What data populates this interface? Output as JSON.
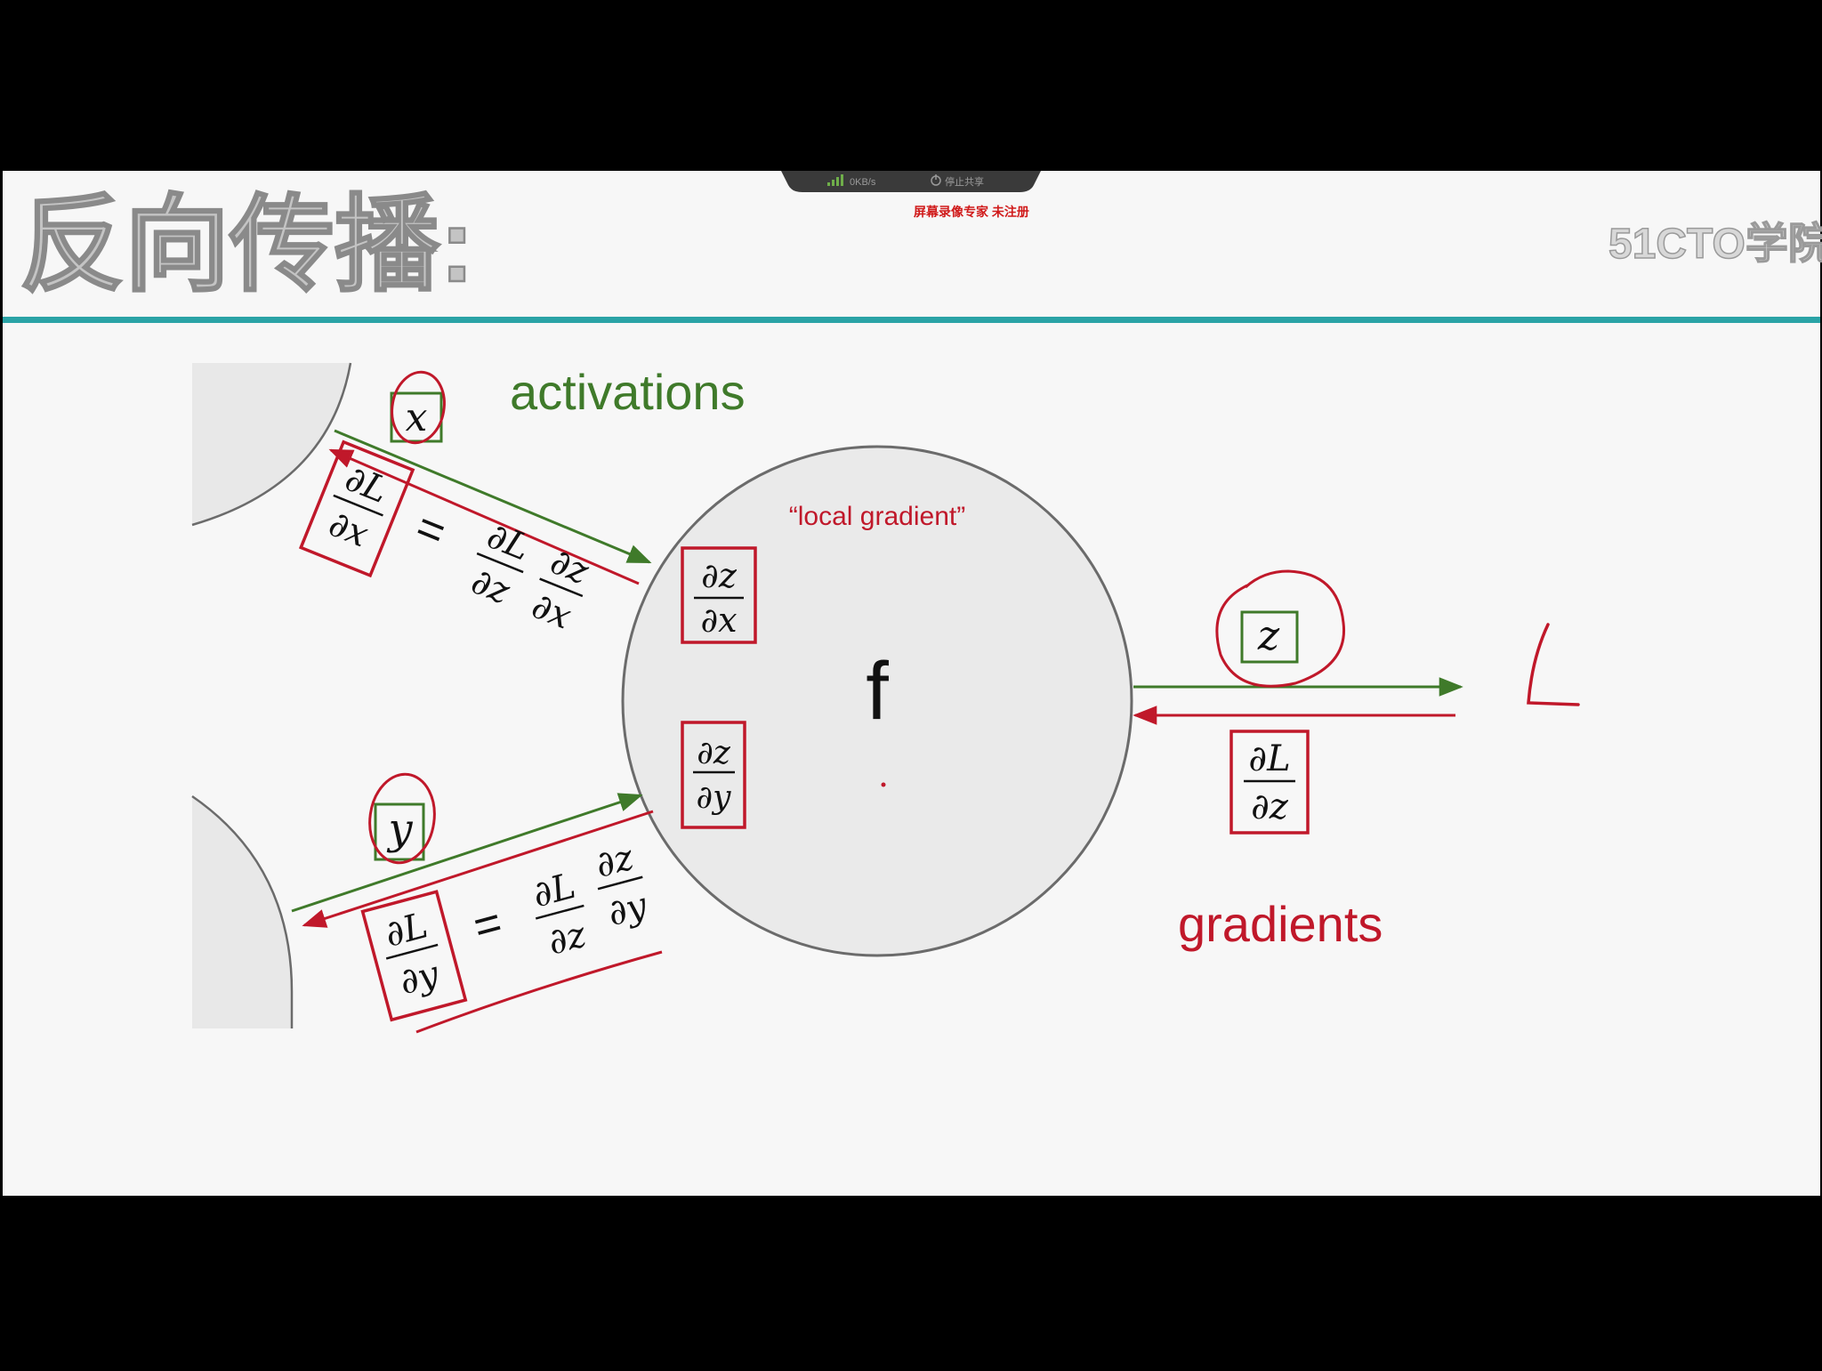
{
  "colors": {
    "frame": "#000000",
    "slide_bg": "#f7f7f7",
    "title_text": "#bcbcbc",
    "teal_rule": "#2aa3a6",
    "green": "#3f7a2a",
    "red": "#c0182a",
    "node_fill": "#eaeaea",
    "node_stroke": "#6b6b6b"
  },
  "recorder_toolbar": {
    "speed": "0KB/s",
    "stop_label": "停止共享",
    "watermark": "屏幕录像专家 未注册"
  },
  "slide": {
    "title": "反向传播:",
    "logo": "51CTO学院"
  },
  "diagram": {
    "activations_label": "activations",
    "gradients_label": "gradients",
    "local_gradient_label": "“local gradient”",
    "node_label": "f",
    "output_label": "L",
    "inputs": {
      "x": "x",
      "y": "y",
      "z": "z"
    },
    "partial": "∂",
    "L": "L",
    "equals": "="
  }
}
